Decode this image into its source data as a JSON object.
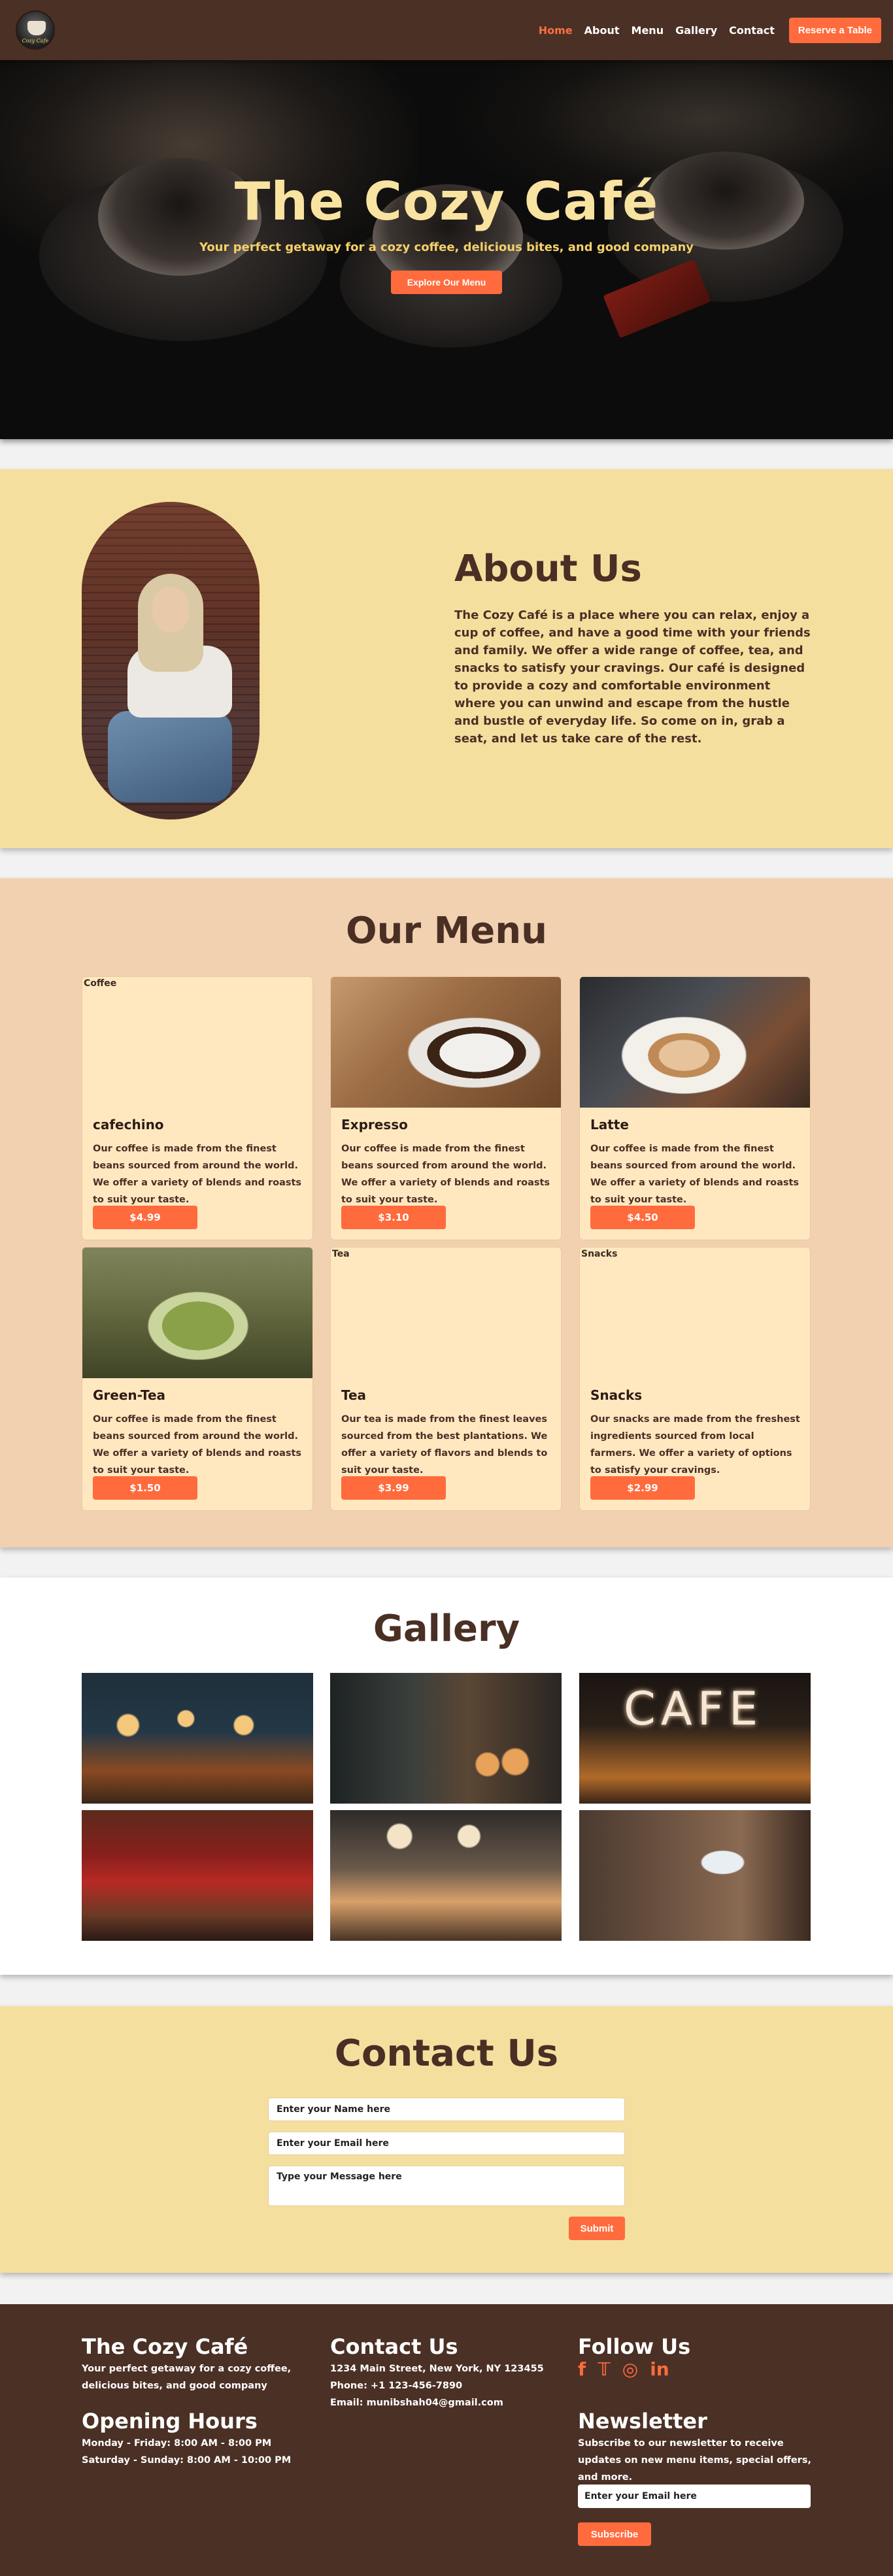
{
  "nav": {
    "logo_text": "Cozy Cafe",
    "links": [
      "Home",
      "About",
      "Menu",
      "Gallery",
      "Contact"
    ],
    "reserve_label": "Reserve a Table",
    "colors": {
      "bg": "#4b3025",
      "accent": "#ff6b3d"
    }
  },
  "hero": {
    "title": "The Cozy Café",
    "subtitle": "Your perfect getaway for a cozy coffee, delicious bites, and good company",
    "button_label": "Explore Our Menu"
  },
  "about": {
    "title": "About Us",
    "text": "The Cozy Café is a place where you can relax, enjoy a cup of coffee, and have a good time with your friends and family. We offer a wide range of coffee, tea, and snacks to satisfy your cravings. Our café is designed to provide a cozy and comfortable environment where you can unwind and escape from the hustle and bustle of everyday life. So come on in, grab a seat, and let us take care of the rest."
  },
  "menu": {
    "title": "Our Menu",
    "items": [
      {
        "alt": "Coffee",
        "name": "cafechino",
        "desc": "Our coffee is made from the finest beans sourced from around the world. We offer a variety of blends and roasts to suit your taste.",
        "price": "$4.99"
      },
      {
        "alt": "",
        "name": "Expresso",
        "desc": "Our coffee is made from the finest beans sourced from around the world. We offer a variety of blends and roasts to suit your taste.",
        "price": "$3.10"
      },
      {
        "alt": "",
        "name": "Latte",
        "desc": "Our coffee is made from the finest beans sourced from around the world. We offer a variety of blends and roasts to suit your taste.",
        "price": "$4.50"
      },
      {
        "alt": "",
        "name": "Green-Tea",
        "desc": "Our coffee is made from the finest beans sourced from around the world. We offer a variety of blends and roasts to suit your taste.",
        "price": "$1.50"
      },
      {
        "alt": "Tea",
        "name": "Tea",
        "desc": "Our tea is made from the finest leaves sourced from the best plantations. We offer a variety of flavors and blends to suit your taste.",
        "price": "$3.99"
      },
      {
        "alt": "Snacks",
        "name": "Snacks",
        "desc": "Our snacks are made from the freshest ingredients sourced from local farmers. We offer a variety of options to satisfy your cravings.",
        "price": "$2.99"
      }
    ]
  },
  "gallery": {
    "title": "Gallery",
    "sign_text": "CAFE"
  },
  "contact": {
    "title": "Contact Us",
    "name_placeholder": "Enter your Name here",
    "email_placeholder": "Enter your Email here",
    "message_placeholder": "Type your Message here",
    "submit_label": "Submit"
  },
  "footer": {
    "brand_title": "The Cozy Café",
    "brand_tagline": "Your perfect getaway for a cozy coffee, delicious bites, and good company",
    "hours_title": "Opening Hours",
    "hours_weekday": "Monday - Friday: 8:00 AM - 8:00 PM",
    "hours_weekend": "Saturday - Sunday: 8:00 AM - 10:00 PM",
    "contact_title": "Contact Us",
    "address": "1234 Main Street, New York, NY 123455",
    "phone": "Phone: +1 123-456-7890",
    "email": "Email: munibshah04@gmail.com",
    "follow_title": "Follow Us",
    "social_icons": [
      "facebook-icon",
      "twitter-icon",
      "instagram-icon",
      "linkedin-icon"
    ],
    "newsletter_title": "Newsletter",
    "newsletter_text": "Subscribe to our newsletter to receive updates on new menu items, special offers, and more.",
    "newsletter_placeholder": "Enter your Email here",
    "subscribe_label": "Subscribe"
  }
}
